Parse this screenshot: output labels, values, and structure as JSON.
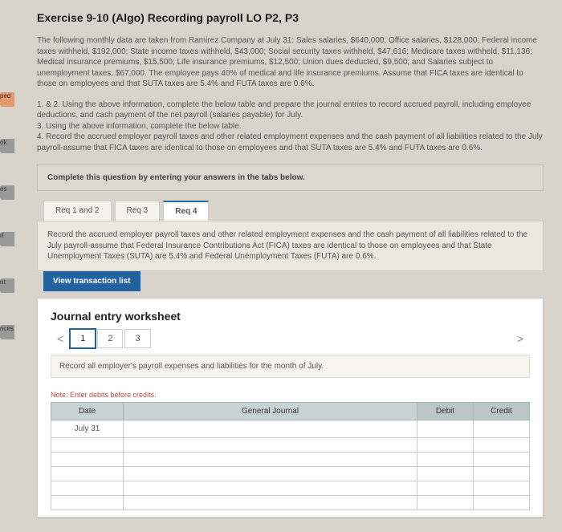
{
  "left_labels": [
    "ped",
    "ok",
    "es",
    "rt",
    "nt",
    "nces"
  ],
  "title": "Exercise 9-10 (Algo) Recording payroll LO P2, P3",
  "problem": "The following monthly data are taken from Ramirez Company at July 31: Sales salaries, $640,000; Office salaries, $128,000; Federal income taxes withheld, $192,000; State income taxes withheld, $43,000; Social security taxes withheld, $47,616; Medicare taxes withheld, $11,136; Medical insurance premiums, $15,500; Life insurance premiums, $12,500; Union dues deducted, $9,500; and Salaries subject to unemployment taxes, $67,000. The employee pays 40% of medical and life insurance premiums. Assume that FICA taxes are identical to those on employees and that SUTA taxes are 5.4% and FUTA taxes are 0.6%.",
  "steps": "1. & 2. Using the above information, complete the below table and prepare the journal entries to record accrued payroll, including employee deductions, and cash payment of the net payroll (salaries payable) for July.\n3. Using the above information, complete the below table.\n4. Record the accrued employer payroll taxes and other related employment expenses and the cash payment of all liabilities related to the July payroll-assume that FICA taxes are identical to those on employees and that SUTA taxes are 5.4% and FUTA taxes are 0.6%.",
  "instruction_bar": "Complete this question by entering your answers in the tabs below.",
  "req_tabs": {
    "tab1": "Req 1 and 2",
    "tab2": "Req 3",
    "tab3": "Req 4"
  },
  "req_panel": "Record the accrued employer payroll taxes and other related employment expenses and the cash payment of all liabilities related to the July payroll-assume that Federal Insurance Contributions Act (FICA) taxes are identical to those on employees and that State Unemployment Taxes (SUTA) are 5.4% and Federal Unemployment Taxes (FUTA) are 0.6%.",
  "view_button": "View transaction list",
  "worksheet": {
    "title": "Journal entry worksheet",
    "pages": [
      "1",
      "2",
      "3"
    ],
    "instruction": "Record all employer's payroll expenses and liabilities for the month of July.",
    "note": "Note: Enter debits before credits.",
    "headers": {
      "date": "Date",
      "gj": "General Journal",
      "debit": "Debit",
      "credit": "Credit"
    },
    "date_value": "July 31"
  }
}
